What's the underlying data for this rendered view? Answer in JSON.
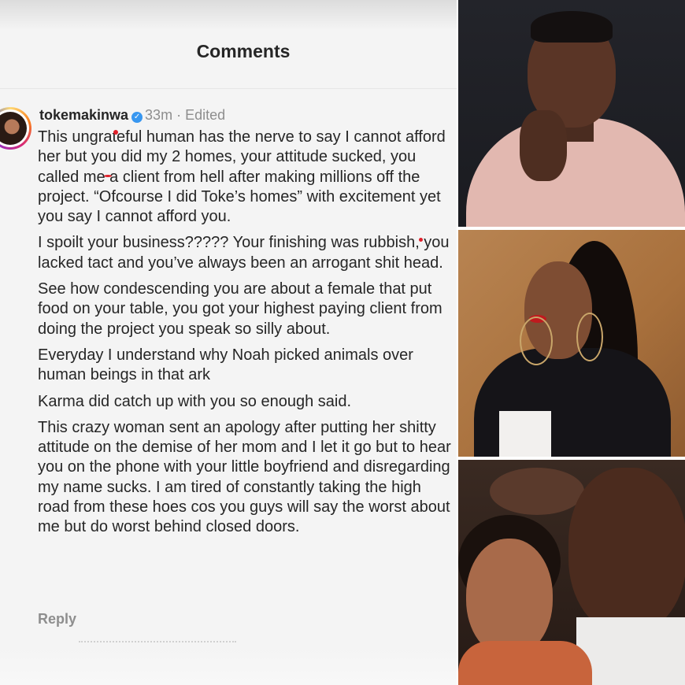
{
  "header": {
    "title": "Comments"
  },
  "comment": {
    "username": "tokemakinwa",
    "time": "33m",
    "edited": "Edited",
    "paragraphs": [
      "This ungrateful human has the nerve to say I cannot afford her but you did my 2 homes, your attitude sucked, you called me a client from hell after making millions off the project. “Ofcourse I did Toke’s homes” with excitement yet you say I cannot afford you.",
      "I spoilt your business????? Your finishing was rubbish, you lacked tact and you’ve always been an arrogant shit head.",
      "See how condescending you are about a female that put food on your table, you got your highest paying client from doing the project you speak so silly about.",
      "Everyday I understand why Noah picked animals over human beings in that ark",
      "Karma did catch up with you so enough said.",
      "This crazy woman sent an apology after putting her shitty attitude on the demise of her mom and I let it go but to hear you on the phone with your little boyfriend and disregarding my name sucks. I am tired of constantly taking the high road from these hoes cos you guys will say the worst about me but do worst behind closed doors."
    ],
    "reply_label": "Reply"
  },
  "icons": {
    "verified": "verified-badge-icon",
    "avatar": "profile-avatar"
  },
  "colors": {
    "verified": "#3897f0",
    "meta": "#8e8e8e",
    "text": "#262626"
  }
}
